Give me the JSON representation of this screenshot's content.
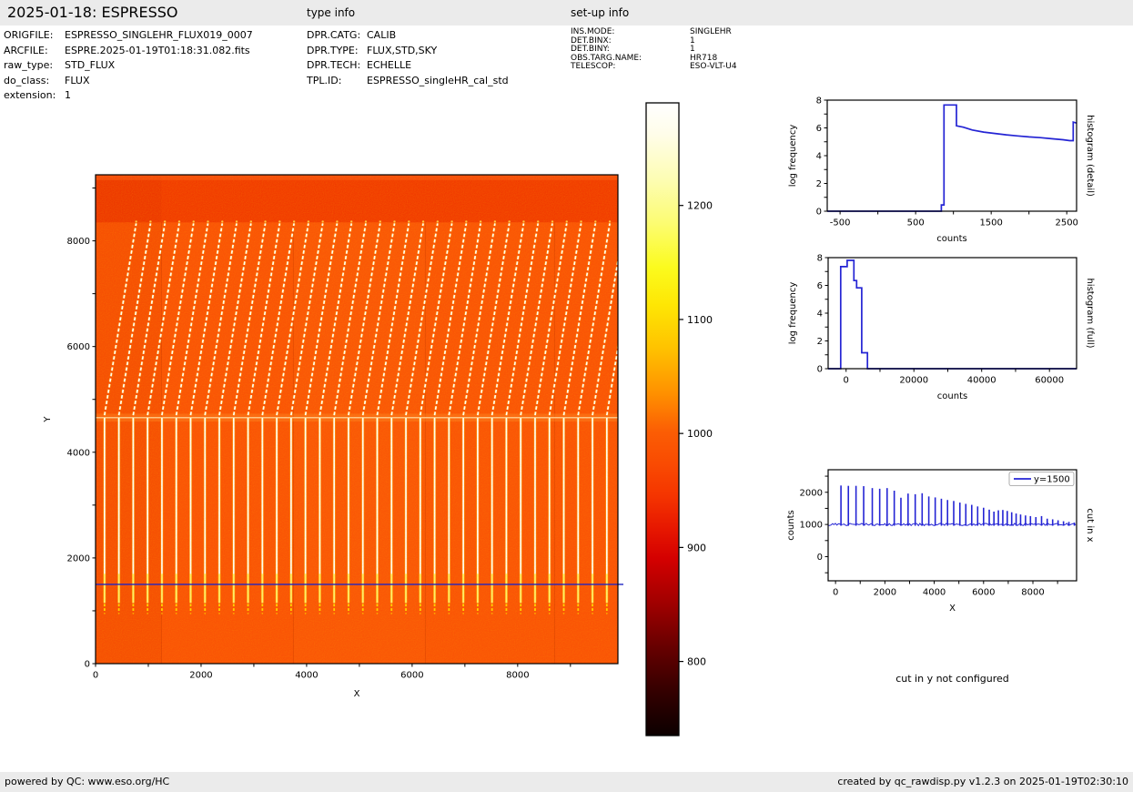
{
  "header": {
    "title": "2025-01-18: ESPRESSO",
    "type_info_heading": "type info",
    "setup_info_heading": "set-up info"
  },
  "file_info": {
    "rows": [
      {
        "label": "ORIGFILE:",
        "value": "ESPRESSO_SINGLEHR_FLUX019_0007"
      },
      {
        "label": "ARCFILE:",
        "value": "ESPRE.2025-01-19T01:18:31.082.fits"
      },
      {
        "label": "raw_type:",
        "value": "STD_FLUX"
      },
      {
        "label": "do_class:",
        "value": "FLUX"
      },
      {
        "label": "extension:",
        "value": "1"
      }
    ]
  },
  "type_info": {
    "rows": [
      {
        "label": "DPR.CATG:",
        "value": "CALIB"
      },
      {
        "label": "DPR.TYPE:",
        "value": "FLUX,STD,SKY"
      },
      {
        "label": "DPR.TECH:",
        "value": "ECHELLE"
      },
      {
        "label": "TPL.ID:",
        "value": "ESPRESSO_singleHR_cal_std"
      }
    ]
  },
  "setup_info": {
    "rows": [
      {
        "label": "INS.MODE:",
        "value": "SINGLEHR"
      },
      {
        "label": "DET.BINX:",
        "value": "1"
      },
      {
        "label": "DET.BINY:",
        "value": "1"
      },
      {
        "label": "OBS.TARG.NAME:",
        "value": "HR718"
      },
      {
        "label": "TELESCOP:",
        "value": "ESO-VLT-U4"
      }
    ]
  },
  "cut_y": {
    "note": "cut in y not configured"
  },
  "footer": {
    "left": "powered by QC: www.eso.org/HC",
    "right": "created by qc_rawdisp.py v1.2.3 on 2025-01-19T02:30:10"
  },
  "colors": {
    "bar_bg": "#ebebeb",
    "curve": "#2424d4",
    "cut_line": "#1f25c4",
    "image_base_orange": "#fa5306",
    "axis": "#000000"
  },
  "chart_data": [
    {
      "id": "main-image",
      "type": "heatmap",
      "xlabel": "X",
      "ylabel": "Y",
      "xlim": [
        0,
        9900
      ],
      "ylim": [
        0,
        9250
      ],
      "xticks": {
        "first": 0,
        "step": 1000,
        "labeled": [
          0,
          2000,
          4000,
          6000,
          8000
        ]
      },
      "yticks": {
        "first": 0,
        "step": 1000,
        "labeled": [
          0,
          2000,
          4000,
          6000,
          8000
        ]
      },
      "cut_line_y": 1500,
      "value_range": [
        735,
        1290
      ],
      "regions": {
        "top_band_y": 8350,
        "bright_row_y": 4655,
        "stripe_bottom_y": 1000
      },
      "stripes": {
        "count": 36,
        "x_start": 170,
        "spacing": 272,
        "diag_y": [
          4700,
          8330
        ],
        "diag_x_shift": 600,
        "vert_y": [
          1150,
          4650
        ],
        "tip_y": [
          1000,
          1140
        ]
      }
    },
    {
      "id": "colorbar",
      "type": "colorbar",
      "colormap": "hot",
      "vmin": 735,
      "vmax": 1290,
      "ticks": [
        1200,
        1100,
        1000,
        900,
        800
      ]
    },
    {
      "id": "hist-detail",
      "type": "line",
      "xlabel": "counts",
      "ylabel": "log frequency",
      "right_label": "histogram (detail)",
      "xlim": [
        -670,
        2630
      ],
      "ylim": [
        0,
        8
      ],
      "xticks": {
        "first": -500,
        "step": 500,
        "labeled": [
          -500,
          500,
          1500,
          2500
        ]
      },
      "yticks": {
        "first": 0,
        "step": 1,
        "labeled": [
          0,
          2,
          4,
          6,
          8
        ]
      },
      "points": [
        [
          -670,
          0
        ],
        [
          840,
          0
        ],
        [
          840,
          0.45
        ],
        [
          875,
          0.45
        ],
        [
          875,
          7.65
        ],
        [
          1040,
          7.65
        ],
        [
          1040,
          6.15
        ],
        [
          1130,
          6.05
        ],
        [
          1250,
          5.85
        ],
        [
          1400,
          5.7
        ],
        [
          1550,
          5.6
        ],
        [
          1700,
          5.5
        ],
        [
          1850,
          5.42
        ],
        [
          2000,
          5.35
        ],
        [
          2150,
          5.3
        ],
        [
          2300,
          5.22
        ],
        [
          2450,
          5.15
        ],
        [
          2540,
          5.08
        ],
        [
          2585,
          5.08
        ],
        [
          2585,
          6.42
        ],
        [
          2630,
          6.35
        ]
      ]
    },
    {
      "id": "hist-full",
      "type": "line",
      "xlabel": "counts",
      "ylabel": "log frequency",
      "right_label": "histogram (full)",
      "xlim": [
        -5300,
        68000
      ],
      "ylim": [
        0,
        8
      ],
      "xticks": {
        "first": 0,
        "step": 10000,
        "labeled": [
          0,
          20000,
          40000,
          60000
        ]
      },
      "yticks": {
        "first": 0,
        "step": 1,
        "labeled": [
          0,
          2,
          4,
          6,
          8
        ]
      },
      "points": [
        [
          -5300,
          0
        ],
        [
          -1600,
          0
        ],
        [
          -1600,
          7.35
        ],
        [
          300,
          7.35
        ],
        [
          300,
          7.8
        ],
        [
          2300,
          7.8
        ],
        [
          2300,
          6.35
        ],
        [
          3100,
          6.35
        ],
        [
          3100,
          5.82
        ],
        [
          4600,
          5.82
        ],
        [
          4600,
          1.15
        ],
        [
          6300,
          1.15
        ],
        [
          6300,
          0
        ],
        [
          68000,
          0
        ]
      ]
    },
    {
      "id": "cut-x",
      "type": "line",
      "xlabel": "X",
      "ylabel": "counts",
      "right_label": "cut in x",
      "legend": "y=1500",
      "xlim": [
        -300,
        9770
      ],
      "ylim": [
        -750,
        2700
      ],
      "xticks": {
        "first": 0,
        "step": 1000,
        "labeled": [
          0,
          2000,
          4000,
          6000,
          8000
        ]
      },
      "yticks": {
        "first": -500,
        "step": 500,
        "labeled": [
          0,
          1000,
          2000
        ]
      },
      "baseline": 1000,
      "spikes": [
        [
          220,
          2210
        ],
        [
          520,
          2200
        ],
        [
          830,
          2200
        ],
        [
          1140,
          2190
        ],
        [
          1490,
          2130
        ],
        [
          1790,
          2110
        ],
        [
          2090,
          2130
        ],
        [
          2380,
          2050
        ],
        [
          2650,
          1830
        ],
        [
          2940,
          1960
        ],
        [
          3230,
          1940
        ],
        [
          3510,
          1970
        ],
        [
          3780,
          1870
        ],
        [
          4040,
          1840
        ],
        [
          4290,
          1800
        ],
        [
          4540,
          1760
        ],
        [
          4790,
          1730
        ],
        [
          5040,
          1680
        ],
        [
          5280,
          1640
        ],
        [
          5520,
          1610
        ],
        [
          5760,
          1560
        ],
        [
          6000,
          1520
        ],
        [
          6230,
          1460
        ],
        [
          6420,
          1400
        ],
        [
          6600,
          1440
        ],
        [
          6780,
          1450
        ],
        [
          6960,
          1420
        ],
        [
          7140,
          1380
        ],
        [
          7320,
          1340
        ],
        [
          7500,
          1310
        ],
        [
          7700,
          1280
        ],
        [
          7900,
          1260
        ],
        [
          8120,
          1230
        ],
        [
          8350,
          1260
        ],
        [
          8580,
          1180
        ],
        [
          8800,
          1160
        ],
        [
          9020,
          1130
        ],
        [
          9240,
          1100
        ],
        [
          9460,
          1080
        ],
        [
          9680,
          1060
        ]
      ]
    }
  ]
}
